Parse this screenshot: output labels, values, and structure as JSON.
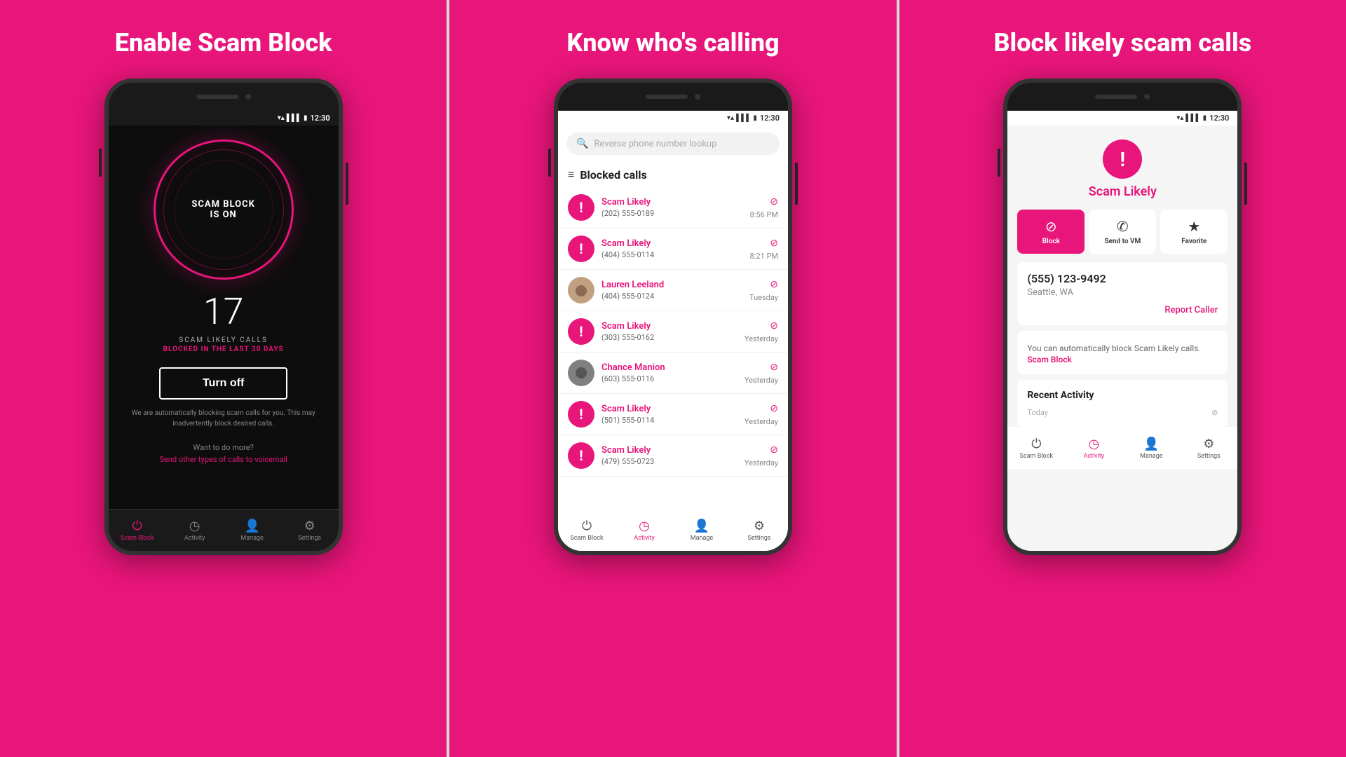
{
  "panels": [
    {
      "id": "panel1",
      "title": "Enable Scam Block",
      "theme": "dark",
      "circle_text": "SCAM BLOCK\nIS ON",
      "count": "17",
      "scam_calls_label": "SCAM LIKELY CALLS",
      "blocked_label": "BLOCKED IN THE LAST 30 DAYS",
      "turn_off_btn": "Turn off",
      "blocking_text": "We are automatically blocking scam calls for you. This may inadvertently block desired calls.",
      "want_more": "Want to do more?",
      "send_voicemail": "Send other types of calls to voicemail",
      "status_time": "12:30",
      "nav": [
        {
          "label": "Scam Block",
          "icon": "⏻",
          "active": true
        },
        {
          "label": "Activity",
          "icon": "🕐",
          "active": false
        },
        {
          "label": "Manage",
          "icon": "👤",
          "active": false
        },
        {
          "label": "Settings",
          "icon": "⚙",
          "active": false
        }
      ]
    },
    {
      "id": "panel2",
      "title": "Know who's calling",
      "theme": "light",
      "search_placeholder": "Reverse phone number lookup",
      "blocked_calls_title": "Blocked calls",
      "status_time": "12:30",
      "calls": [
        {
          "name": "Scam Likely",
          "number": "(202) 555-0189",
          "time": "8:56 PM",
          "type": "scam"
        },
        {
          "name": "Scam Likely",
          "number": "(404) 555-0114",
          "time": "8:21 PM",
          "type": "scam"
        },
        {
          "name": "Lauren Leeland",
          "number": "(404) 555-0124",
          "time": "Tuesday",
          "type": "person"
        },
        {
          "name": "Scam Likely",
          "number": "(303) 555-0162",
          "time": "Yesterday",
          "type": "scam"
        },
        {
          "name": "Chance Manion",
          "number": "(603) 555-0116",
          "time": "Yesterday",
          "type": "person2"
        },
        {
          "name": "Scam Likely",
          "number": "(501) 555-0114",
          "time": "Yesterday",
          "type": "scam"
        },
        {
          "name": "Scam Likely",
          "number": "(479) 555-0723",
          "time": "Yesterday",
          "type": "scam"
        }
      ],
      "nav": [
        {
          "label": "Scam Block",
          "icon": "⏻",
          "active": false
        },
        {
          "label": "Activity",
          "icon": "🕐",
          "active": true
        },
        {
          "label": "Manage",
          "icon": "👤",
          "active": false
        },
        {
          "label": "Settings",
          "icon": "⚙",
          "active": false
        }
      ]
    },
    {
      "id": "panel3",
      "title": "Block likely scam calls",
      "theme": "light",
      "status_time": "12:30",
      "scam_likely_label": "Scam Likely",
      "action_buttons": [
        {
          "label": "Block",
          "icon": "⊘",
          "active": true
        },
        {
          "label": "Send to VM",
          "icon": "✆",
          "active": false
        },
        {
          "label": "Favorite",
          "icon": "★",
          "active": false
        }
      ],
      "caller_number": "(555) 123-9492",
      "caller_location": "Seattle, WA",
      "report_caller": "Report Caller",
      "promo_text": "You can automatically block Scam Likely calls.",
      "promo_link": "Scam Block",
      "recent_title": "Recent Activity",
      "today_label": "Today",
      "nav": [
        {
          "label": "Scam Block",
          "icon": "⏻",
          "active": false
        },
        {
          "label": "Activity",
          "icon": "🕐",
          "active": true
        },
        {
          "label": "Manage",
          "icon": "👤",
          "active": false
        },
        {
          "label": "Settings",
          "icon": "⚙",
          "active": false
        }
      ]
    }
  ]
}
